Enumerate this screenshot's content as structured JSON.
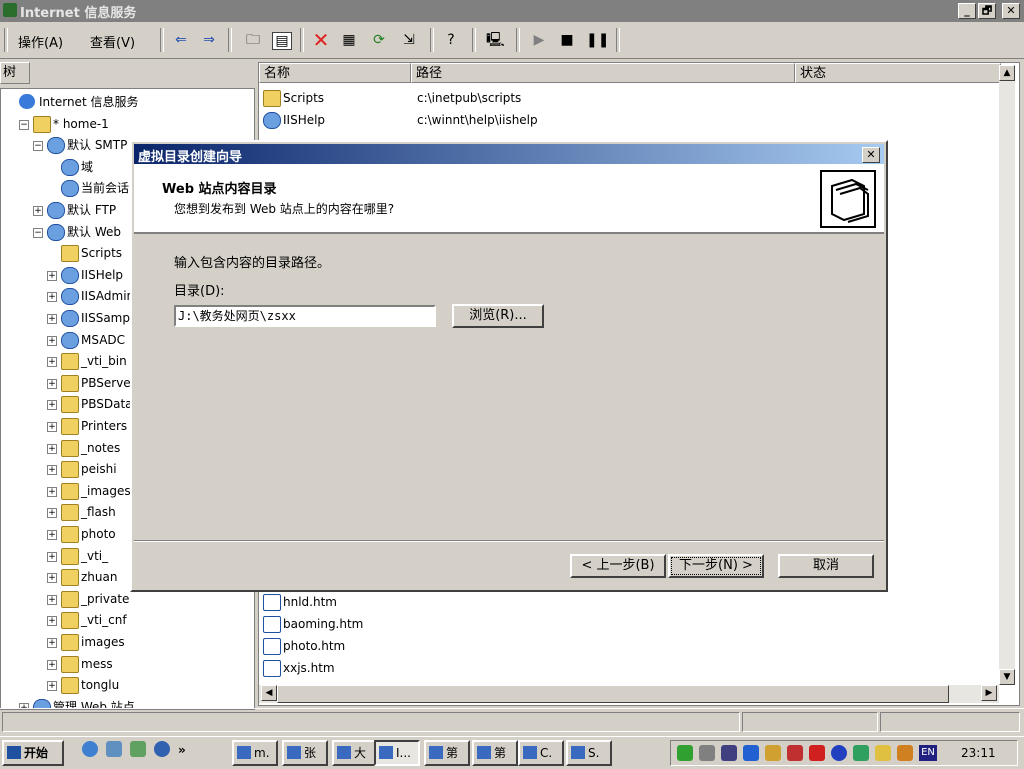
{
  "window": {
    "title": "Internet 信息服务",
    "min": "_",
    "max": "🗗",
    "close": "✕"
  },
  "menu": {
    "action": "操作(A)",
    "view": "查看(V)"
  },
  "toolbar_icons": [
    "back-arrow-icon",
    "forward-arrow-icon",
    "up-folder-icon",
    "show-tree-icon",
    "delete-icon",
    "properties-icon",
    "refresh-icon",
    "export-icon",
    "help-icon",
    "computer-icon",
    "play-icon",
    "stop-icon",
    "pause-icon"
  ],
  "tree": {
    "header": "树",
    "items": [
      {
        "label": "Internet 信息服务",
        "indent": 0,
        "pm": "",
        "icon": "globe"
      },
      {
        "label": "* home-1",
        "indent": 1,
        "pm": "−",
        "icon": "computer"
      },
      {
        "label": "默认 SMTP",
        "indent": 2,
        "pm": "−",
        "icon": "web"
      },
      {
        "label": "域",
        "indent": 3,
        "pm": "",
        "icon": "web"
      },
      {
        "label": "当前会话",
        "indent": 3,
        "pm": "",
        "icon": "web"
      },
      {
        "label": "默认 FTP",
        "indent": 2,
        "pm": "+",
        "icon": "web"
      },
      {
        "label": "默认 Web",
        "indent": 2,
        "pm": "−",
        "icon": "web"
      },
      {
        "label": "Scripts",
        "indent": 3,
        "pm": "",
        "icon": "folder"
      },
      {
        "label": "IISHelp",
        "indent": 3,
        "pm": "+",
        "icon": "web"
      },
      {
        "label": "IISAdmin",
        "indent": 3,
        "pm": "+",
        "icon": "web"
      },
      {
        "label": "IISSamples",
        "indent": 3,
        "pm": "+",
        "icon": "web"
      },
      {
        "label": "MSADC",
        "indent": 3,
        "pm": "+",
        "icon": "web"
      },
      {
        "label": "_vti_bin",
        "indent": 3,
        "pm": "+",
        "icon": "folder"
      },
      {
        "label": "PBServer",
        "indent": 3,
        "pm": "+",
        "icon": "folder"
      },
      {
        "label": "PBSData",
        "indent": 3,
        "pm": "+",
        "icon": "folder"
      },
      {
        "label": "Printers",
        "indent": 3,
        "pm": "+",
        "icon": "folder"
      },
      {
        "label": "_notes",
        "indent": 3,
        "pm": "+",
        "icon": "folder"
      },
      {
        "label": "peishi",
        "indent": 3,
        "pm": "+",
        "icon": "folder"
      },
      {
        "label": "_images",
        "indent": 3,
        "pm": "+",
        "icon": "folder"
      },
      {
        "label": "_flash",
        "indent": 3,
        "pm": "+",
        "icon": "folder"
      },
      {
        "label": "photo",
        "indent": 3,
        "pm": "+",
        "icon": "folder"
      },
      {
        "label": "_vti_",
        "indent": 3,
        "pm": "+",
        "icon": "folder"
      },
      {
        "label": "zhuan",
        "indent": 3,
        "pm": "+",
        "icon": "folder"
      },
      {
        "label": "_private",
        "indent": 3,
        "pm": "+",
        "icon": "folder"
      },
      {
        "label": "_vti_cnf",
        "indent": 3,
        "pm": "+",
        "icon": "folder"
      },
      {
        "label": "images",
        "indent": 3,
        "pm": "+",
        "icon": "folder"
      },
      {
        "label": "mess",
        "indent": 3,
        "pm": "+",
        "icon": "folder"
      },
      {
        "label": "tonglu",
        "indent": 3,
        "pm": "+",
        "icon": "folder"
      },
      {
        "label": "管理 Web 站点",
        "indent": 1,
        "pm": "+",
        "icon": "web"
      }
    ]
  },
  "list": {
    "columns": [
      "名称",
      "路径",
      "状态"
    ],
    "rows_top": [
      {
        "name": "Scripts",
        "path": "c:\\inetpub\\scripts"
      },
      {
        "name": "IISHelp",
        "path": "c:\\winnt\\help\\iishelp"
      }
    ],
    "rows_bottom": [
      {
        "name": "hnld.htm"
      },
      {
        "name": "baoming.htm"
      },
      {
        "name": "photo.htm"
      },
      {
        "name": "xxjs.htm"
      }
    ]
  },
  "dialog": {
    "title": "虚拟目录创建向导",
    "close": "✕",
    "heading": "Web 站点内容目录",
    "subheading": "您想到发布到 Web 站点上的内容在哪里?",
    "instruction": "输入包含内容的目录路径。",
    "dir_label": "目录(D):",
    "dir_value": "J:\\教务处网页\\zsxx",
    "browse": "浏览(R)...",
    "back": "< 上一步(B)",
    "next": "下一步(N) >",
    "cancel": "取消"
  },
  "taskbar": {
    "start": "开始",
    "tasks": [
      "m.",
      "张",
      "大",
      "I...",
      "第",
      "第",
      "C.",
      "S."
    ],
    "lang": "EN",
    "clock": "23:11"
  }
}
